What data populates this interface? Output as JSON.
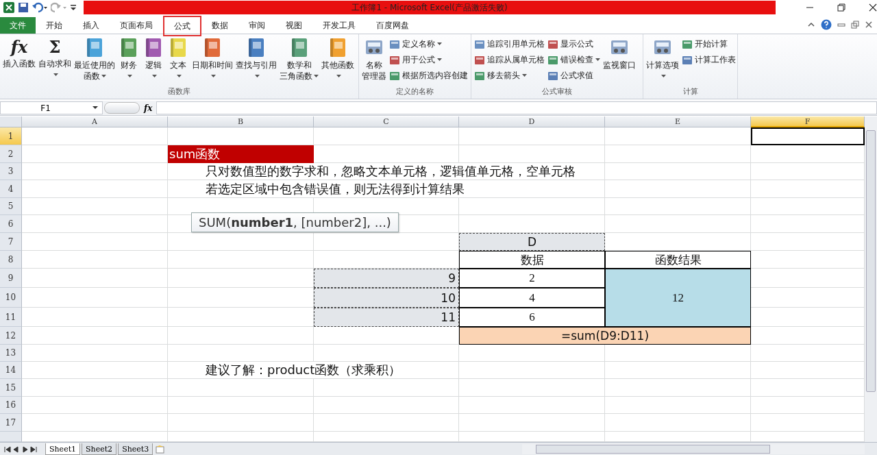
{
  "title_bar": {
    "title": "工作簿1  -  Microsoft Excel(产品激活失败)"
  },
  "tabs": [
    {
      "label": "文件",
      "kind": "file",
      "selected": false
    },
    {
      "label": "开始",
      "kind": "tab",
      "selected": false
    },
    {
      "label": "插入",
      "kind": "tab",
      "selected": false
    },
    {
      "label": "页面布局",
      "kind": "tab",
      "selected": false
    },
    {
      "label": "公式",
      "kind": "tab",
      "selected": true
    },
    {
      "label": "数据",
      "kind": "tab",
      "selected": false
    },
    {
      "label": "审阅",
      "kind": "tab",
      "selected": false
    },
    {
      "label": "视图",
      "kind": "tab",
      "selected": false
    },
    {
      "label": "开发工具",
      "kind": "tab",
      "selected": false
    },
    {
      "label": "百度网盘",
      "kind": "tab",
      "selected": false
    }
  ],
  "ribbon": {
    "groups": [
      {
        "label": "函数库",
        "columns": [
          [
            {
              "kind": "large",
              "glyph": "fx",
              "lines": [
                "插入函数"
              ],
              "dropdown": false
            }
          ],
          [
            {
              "kind": "large",
              "glyph": "Σ",
              "lines": [
                "自动求和"
              ],
              "dropdown": true
            }
          ],
          [
            {
              "kind": "large",
              "lines": [
                "最近使用的",
                "函数"
              ],
              "dropdown": true
            }
          ],
          [
            {
              "kind": "large",
              "lines": [
                "财务"
              ],
              "dropdown": true
            }
          ],
          [
            {
              "kind": "large",
              "lines": [
                "逻辑"
              ],
              "dropdown": true
            }
          ],
          [
            {
              "kind": "large",
              "lines": [
                "文本"
              ],
              "dropdown": true
            }
          ],
          [
            {
              "kind": "large",
              "lines": [
                "日期和时间"
              ],
              "dropdown": true
            }
          ],
          [
            {
              "kind": "large",
              "lines": [
                "查找与引用"
              ],
              "dropdown": true
            }
          ],
          [
            {
              "kind": "large",
              "lines": [
                "数学和",
                "三角函数"
              ],
              "dropdown": true
            }
          ],
          [
            {
              "kind": "large",
              "lines": [
                "其他函数"
              ],
              "dropdown": true
            }
          ]
        ]
      },
      {
        "label": "定义的名称",
        "columns": [
          [
            {
              "kind": "large",
              "lines": [
                "名称",
                "管理器"
              ],
              "dropdown": false
            }
          ],
          [
            {
              "kind": "small",
              "lines": [
                "定义名称"
              ],
              "dropdown": true
            },
            {
              "kind": "small",
              "lines": [
                "用于公式"
              ],
              "dropdown": true
            },
            {
              "kind": "small",
              "lines": [
                "根据所选内容创建"
              ],
              "dropdown": false
            }
          ]
        ]
      },
      {
        "label": "公式审核",
        "columns": [
          [
            {
              "kind": "small",
              "lines": [
                "追踪引用单元格"
              ],
              "dropdown": false
            },
            {
              "kind": "small",
              "lines": [
                "追踪从属单元格"
              ],
              "dropdown": false
            },
            {
              "kind": "small",
              "lines": [
                "移去箭头"
              ],
              "dropdown": true
            }
          ],
          [
            {
              "kind": "small",
              "lines": [
                "显示公式"
              ],
              "dropdown": false
            },
            {
              "kind": "small",
              "lines": [
                "错误检查"
              ],
              "dropdown": true
            },
            {
              "kind": "small",
              "lines": [
                "公式求值"
              ],
              "dropdown": false
            }
          ],
          [
            {
              "kind": "large",
              "lines": [
                "监视窗口"
              ],
              "dropdown": false
            }
          ]
        ]
      },
      {
        "label": "计算",
        "columns": [
          [
            {
              "kind": "large",
              "lines": [
                "计算选项"
              ],
              "dropdown": true
            }
          ],
          [
            {
              "kind": "small",
              "lines": [
                "开始计算"
              ],
              "dropdown": false
            },
            {
              "kind": "small",
              "lines": [
                "计算工作表"
              ],
              "dropdown": false
            }
          ]
        ]
      }
    ]
  },
  "formula_bar": {
    "name_box": "F1",
    "fx": "fx"
  },
  "sheet": {
    "columns": [
      {
        "label": "A",
        "selected": false
      },
      {
        "label": "B",
        "selected": false
      },
      {
        "label": "C",
        "selected": false
      },
      {
        "label": "D",
        "selected": false
      },
      {
        "label": "E",
        "selected": false
      },
      {
        "label": "F",
        "selected": true
      }
    ],
    "rows": [
      {
        "label": "1",
        "selected": true,
        "cells": {
          "F": {
            "kind": "active"
          }
        }
      },
      {
        "label": "2",
        "selected": false,
        "cells": {
          "B": {
            "kind": "title",
            "text": "sum函数"
          }
        }
      },
      {
        "label": "3",
        "selected": false,
        "cells": {
          "B": {
            "kind": "note",
            "text": "只对数值型的数字求和，忽略文本单元格，逻辑值单元格，空单元格"
          }
        }
      },
      {
        "label": "4",
        "selected": false,
        "cells": {
          "B": {
            "kind": "note",
            "text": "若选定区域中包含错误值，则无法得到计算结果"
          }
        }
      },
      {
        "label": "5",
        "selected": false
      },
      {
        "label": "6",
        "selected": false
      },
      {
        "label": "7",
        "selected": false,
        "cells": {
          "D": {
            "kind": "header",
            "text": "D"
          }
        }
      },
      {
        "label": "8",
        "selected": false,
        "cells": {
          "D": {
            "kind": "label",
            "text": "数据"
          },
          "E": {
            "kind": "label",
            "text": "函数结果"
          }
        }
      },
      {
        "label": "9",
        "selected": false,
        "cells": {
          "C": {
            "kind": "index",
            "text": "9"
          },
          "D": {
            "kind": "value",
            "text": "2"
          },
          "E": {
            "kind": "result",
            "text": "12"
          }
        }
      },
      {
        "label": "10",
        "selected": false,
        "cells": {
          "C": {
            "kind": "index",
            "text": "10"
          },
          "D": {
            "kind": "value",
            "text": "4"
          }
        }
      },
      {
        "label": "11",
        "selected": false,
        "cells": {
          "C": {
            "kind": "index",
            "text": "11"
          },
          "D": {
            "kind": "value",
            "text": "6"
          }
        }
      },
      {
        "label": "12",
        "selected": false,
        "cells": {
          "D": {
            "kind": "formula",
            "text": "=sum(D9:D11)"
          }
        }
      },
      {
        "label": "13",
        "selected": false
      },
      {
        "label": "14",
        "selected": false,
        "cells": {
          "B": {
            "kind": "note",
            "text": "建议了解：product函数（求乘积）"
          }
        }
      },
      {
        "label": "15",
        "selected": false
      },
      {
        "label": "16",
        "selected": false
      },
      {
        "label": "17",
        "selected": false
      }
    ],
    "tooltip": "SUM(**number1**, [number2], ...)"
  },
  "sheet_tabs": [
    {
      "label": "Sheet1",
      "selected": true
    },
    {
      "label": "Sheet2",
      "selected": false
    },
    {
      "label": "Sheet3",
      "selected": false
    }
  ]
}
